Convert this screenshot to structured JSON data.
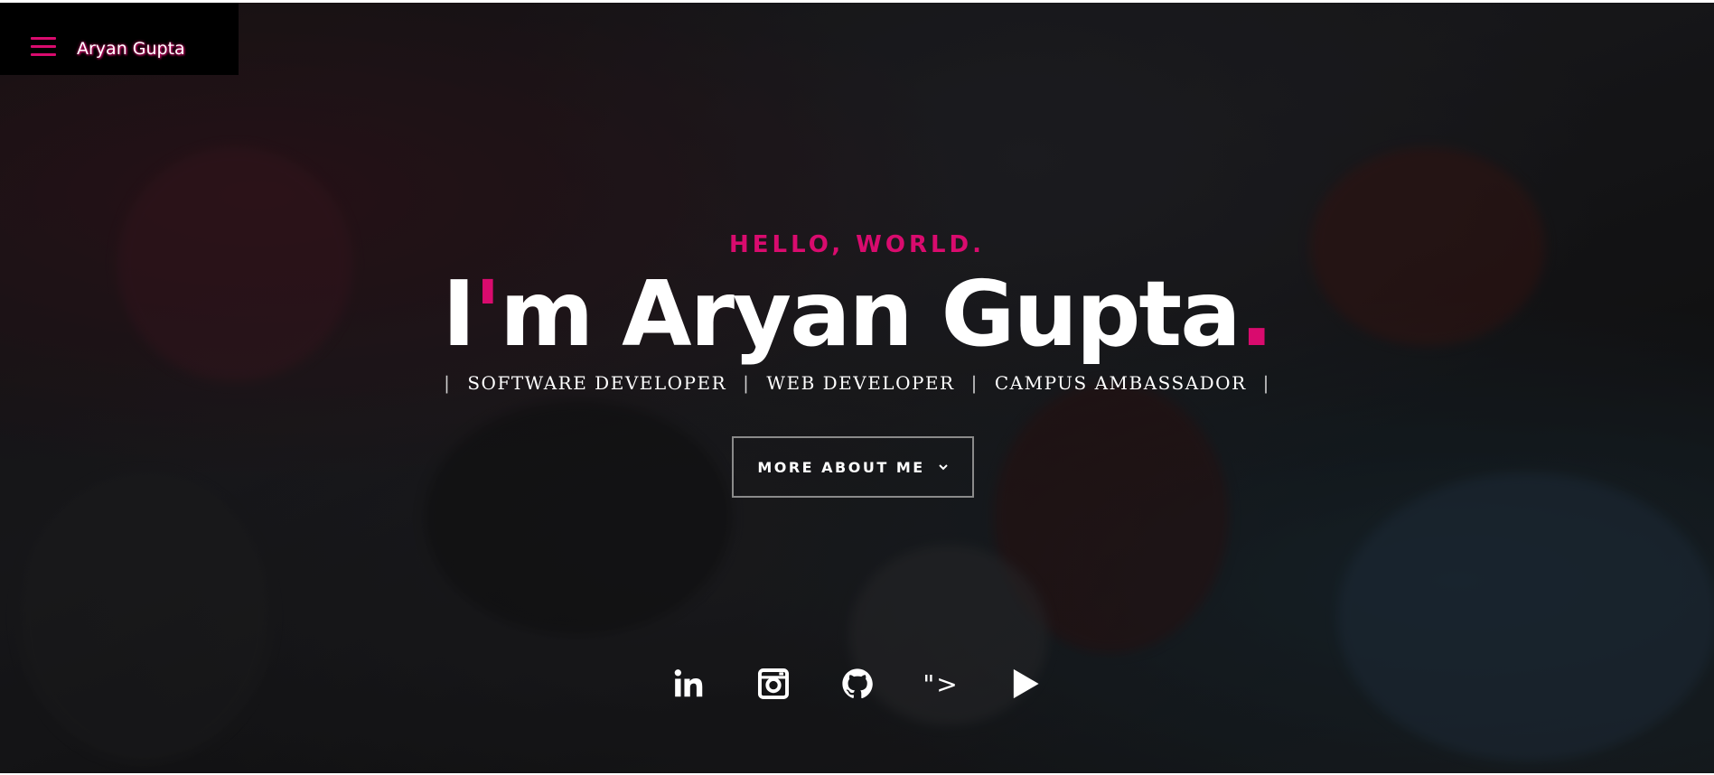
{
  "nav": {
    "brand": "Aryan Gupta",
    "menu_icon": "hamburger-icon"
  },
  "hero": {
    "greeting": "HELLO, WORLD.",
    "headline_prefix": "I",
    "headline_apostrophe": "'",
    "headline_main": "m Aryan Gupta",
    "headline_dot": ".",
    "roles": [
      "SOFTWARE DEVELOPER",
      "WEB DEVELOPER",
      "CAMPUS AMBASSADOR"
    ],
    "role_separator": "|",
    "cta_label": "MORE ABOUT ME",
    "cta_icon": "chevron-down-icon"
  },
  "social": {
    "items": [
      {
        "name": "linkedin-icon"
      },
      {
        "name": "instagram-icon"
      },
      {
        "name": "github-icon"
      },
      {
        "name": "code-text",
        "text": "\">"
      },
      {
        "name": "play-icon"
      }
    ]
  },
  "colors": {
    "accent": "#d90b6e",
    "text": "#ffffff",
    "nav_bg": "#000000"
  }
}
